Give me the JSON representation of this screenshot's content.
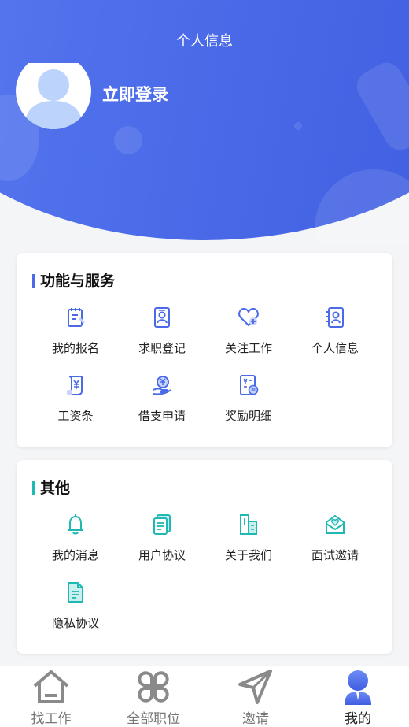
{
  "header": {
    "title": "个人信息",
    "login_label": "立即登录"
  },
  "services": {
    "title": "功能与服务",
    "items": [
      {
        "label": "我的报名",
        "icon": "clipboard-edit-icon"
      },
      {
        "label": "求职登记",
        "icon": "id-badge-icon"
      },
      {
        "label": "关注工作",
        "icon": "heart-plus-icon"
      },
      {
        "label": "个人信息",
        "icon": "contact-card-icon"
      },
      {
        "label": "工资条",
        "icon": "salary-scroll-icon"
      },
      {
        "label": "借支申请",
        "icon": "hand-coin-icon"
      },
      {
        "label": "奖励明细",
        "icon": "reward-bill-icon"
      }
    ]
  },
  "others": {
    "title": "其他",
    "items": [
      {
        "label": "我的消息",
        "icon": "bell-icon"
      },
      {
        "label": "用户协议",
        "icon": "document-stack-icon"
      },
      {
        "label": "关于我们",
        "icon": "building-icon"
      },
      {
        "label": "面试邀请",
        "icon": "envelope-heart-icon"
      },
      {
        "label": "隐私协议",
        "icon": "document-icon"
      }
    ]
  },
  "tabbar": {
    "items": [
      {
        "label": "找工作",
        "icon": "house-icon"
      },
      {
        "label": "全部职位",
        "icon": "clover-grid-icon"
      },
      {
        "label": "邀请",
        "icon": "send-arrow-icon"
      },
      {
        "label": "我的",
        "icon": "user-profile-icon",
        "active": true
      }
    ]
  },
  "colors": {
    "primary": "#4a6ae8",
    "teal": "#1fb8b3",
    "accent_bar_services": "#4a6ae8",
    "accent_bar_others": "#1fb8b3"
  }
}
